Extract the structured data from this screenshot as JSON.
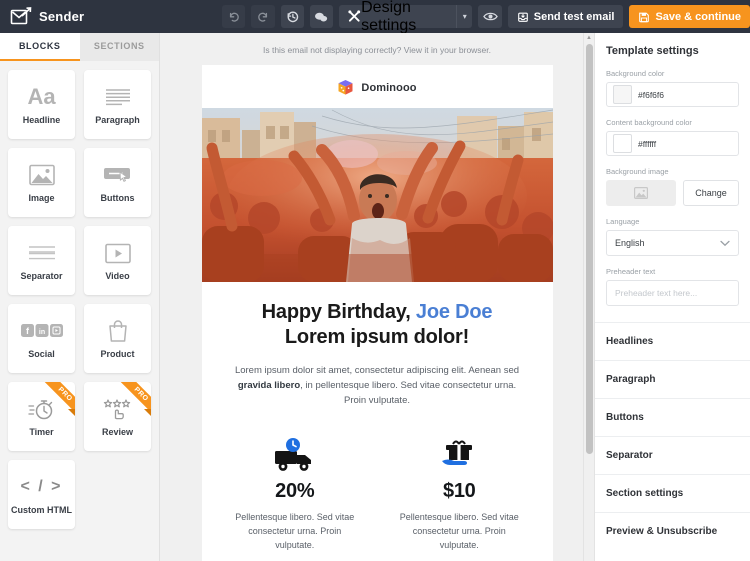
{
  "app": {
    "brand_name": "Sender",
    "brand_icon": "envelope-check-icon"
  },
  "toolbar": {
    "undo_label": "",
    "undo_icon": "undo-arrow-icon",
    "redo_label": "",
    "redo_icon": "redo-arrow-icon",
    "history_icon": "history-clock-icon",
    "comments_icon": "chat-bubbles-icon",
    "design_settings_label": "Design settings",
    "design_settings_icon": "tools-cross-icon",
    "design_settings_caret": "▾",
    "preview_icon": "eye-icon",
    "send_test_label": "Send test email",
    "send_test_icon": "inbox-arrow-icon",
    "save_label": "Save & continue",
    "save_icon": "floppy-disk-icon",
    "accent_color": "#f7941e",
    "bar_color": "#2e3440"
  },
  "sidebar": {
    "tabs": [
      {
        "label": "BLOCKS",
        "active": true
      },
      {
        "label": "SECTIONS",
        "active": false
      }
    ],
    "blocks": [
      {
        "label": "Headline",
        "icon": "text-aa-icon",
        "pro": false
      },
      {
        "label": "Paragraph",
        "icon": "paragraph-lines-icon",
        "pro": false
      },
      {
        "label": "Image",
        "icon": "picture-icon",
        "pro": false
      },
      {
        "label": "Buttons",
        "icon": "button-cursor-icon",
        "pro": false
      },
      {
        "label": "Separator",
        "icon": "separator-lines-icon",
        "pro": false
      },
      {
        "label": "Video",
        "icon": "video-play-icon",
        "pro": false
      },
      {
        "label": "Social",
        "icon": "social-networks-icon",
        "pro": false
      },
      {
        "label": "Product",
        "icon": "shopping-bag-icon",
        "pro": false
      },
      {
        "label": "Timer",
        "icon": "stopwatch-icon",
        "pro": true
      },
      {
        "label": "Review",
        "icon": "star-rating-hand-icon",
        "pro": true
      },
      {
        "label": "Custom HTML",
        "icon": "code-brackets-icon",
        "pro": false
      }
    ],
    "pro_badge": "PRO"
  },
  "canvas": {
    "preheader_note": "Is this email not displaying correctly? View it in your browser.",
    "email": {
      "logo_text": "Dominooo",
      "logo_icon": "cube-logo-icon",
      "hero_image": "holi-festival-crowd-photo",
      "headline_line1_prefix": "Happy Birthday, ",
      "headline_name": "Joe Doe",
      "headline_line2": "Lorem ipsum dolor!",
      "paragraph_part1": "Lorem ipsum dolor sit amet, consectetur adipiscing elit. Aenean sed ",
      "paragraph_bold": "gravida libero",
      "paragraph_part2": ", in pellentesque libero. Sed vitae consectetur urna. Proin vulputate.",
      "columns": [
        {
          "icon": "delivery-truck-clock-icon",
          "value": "20%",
          "description": "Pellentesque libero. Sed vitae consectetur urna. Proin vulputate."
        },
        {
          "icon": "gift-in-hand-icon",
          "value": "$10",
          "description": "Pellentesque libero. Sed vitae consectetur urna. Proin vulputate."
        }
      ]
    }
  },
  "settings": {
    "title": "Template settings",
    "background_color": {
      "label": "Background color",
      "value": "#f6f6f6",
      "swatch": "#f6f6f6"
    },
    "content_background_color": {
      "label": "Content background color",
      "value": "#ffffff",
      "swatch": "#ffffff"
    },
    "background_image": {
      "label": "Background image",
      "thumb_icon": "picture-icon",
      "change_label": "Change"
    },
    "language": {
      "label": "Language",
      "value": "English",
      "caret": "⌄"
    },
    "preheader": {
      "label": "Preheader text",
      "value": "",
      "placeholder": "Preheader text here..."
    },
    "sections": [
      {
        "label": "Headlines"
      },
      {
        "label": "Paragraph"
      },
      {
        "label": "Buttons"
      },
      {
        "label": "Separator"
      },
      {
        "label": "Section settings"
      },
      {
        "label": "Preview & Unsubscribe"
      }
    ]
  }
}
